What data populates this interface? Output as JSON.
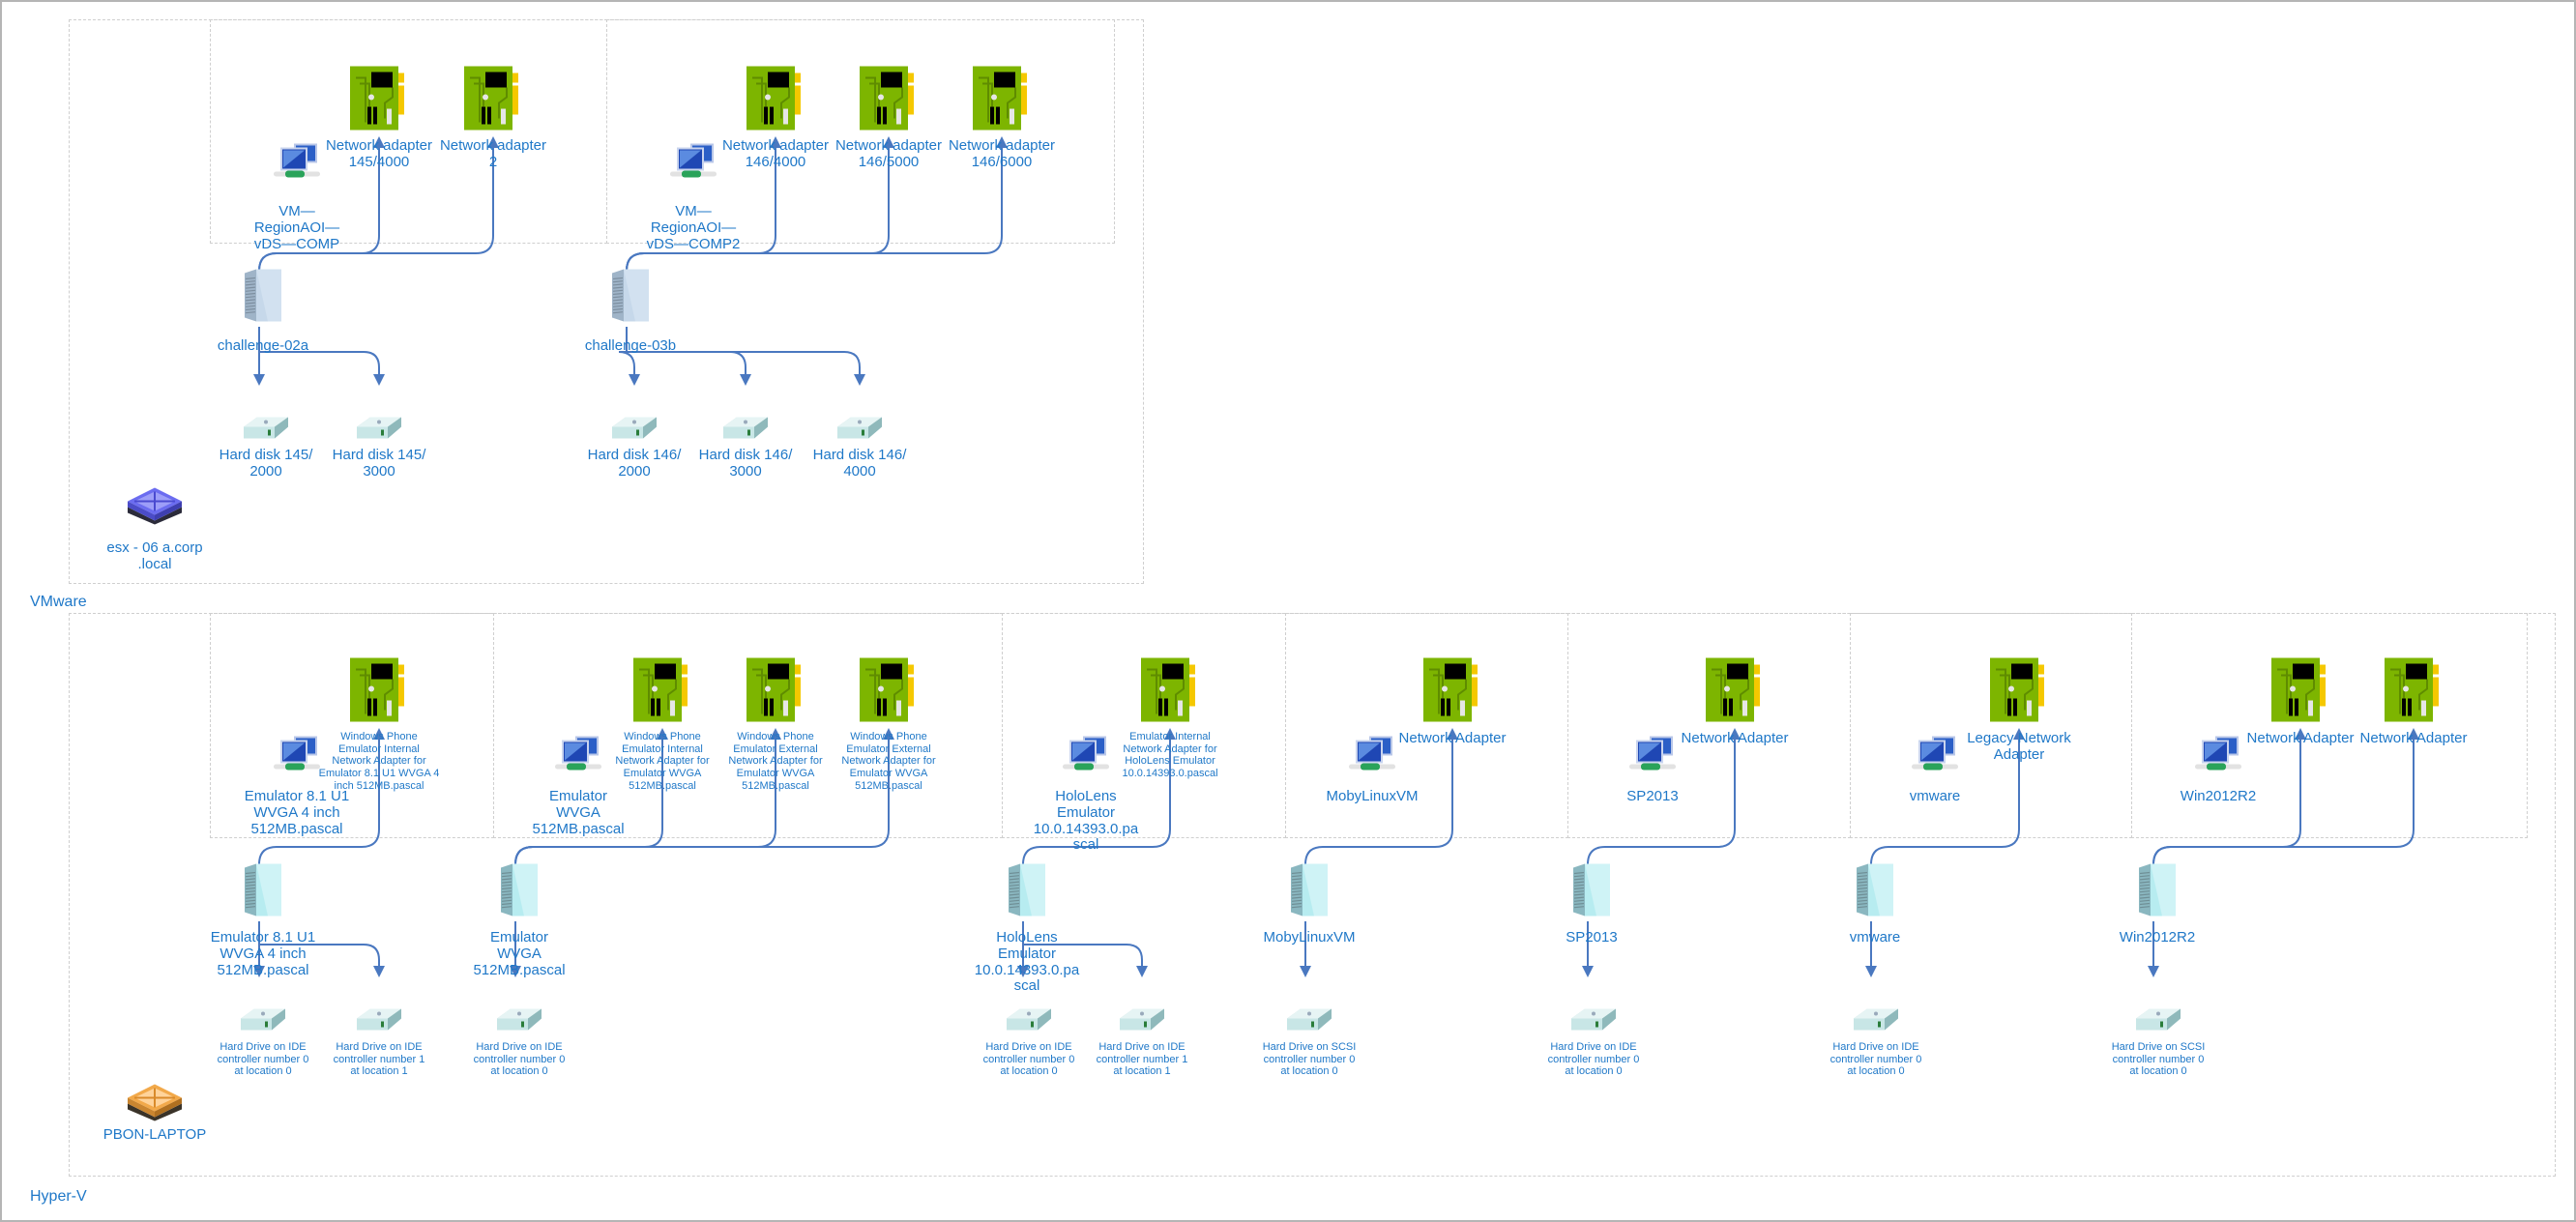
{
  "colors": {
    "text": "#1f78c8",
    "wire": "#4a78c0",
    "nic_green": "#7db500",
    "nic_yellow": "#f5c800"
  },
  "groups": {
    "vmware": {
      "label": "VMware",
      "host": {
        "label": "esx - 06 a.corp\n.local",
        "icon": "esx-host-icon"
      },
      "vms": [
        {
          "switch_label": "VM—\nRegionAOI—\nvDS—COMP",
          "server_label": "challenge-02a",
          "adapters": [
            "Network adapter\n145/4000",
            "Network adapter\n2"
          ],
          "disks": [
            "Hard disk 145/\n2000",
            "Hard disk 145/\n3000"
          ]
        },
        {
          "switch_label": "VM—\nRegionAOI—\nvDS—COMP2",
          "server_label": "challenge-03b",
          "adapters": [
            "Network adapter\n146/4000",
            "Network adapter\n146/5000",
            "Network adapter\n146/6000"
          ],
          "disks": [
            "Hard disk 146/\n2000",
            "Hard disk 146/\n3000",
            "Hard disk 146/\n4000"
          ]
        }
      ]
    },
    "hyperv": {
      "label": "Hyper-V",
      "host": {
        "label": "PBON-LAPTOP",
        "icon": "hyperv-host-icon"
      },
      "vms": [
        {
          "switch_label": "Emulator 8.1 U1\nWVGA 4 inch\n512MB.pascal",
          "server_label": "Emulator 8.1 U1\nWVGA 4 inch\n512MB.pascal",
          "adapters": [
            "Windows Phone\nEmulator Internal\nNetwork Adapter for\nEmulator 8.1 U1 WVGA 4\ninch 512MB.pascal"
          ],
          "disks": [
            "Hard Drive on IDE\ncontroller number 0\nat location 0",
            "Hard Drive on IDE\ncontroller number 1\nat location 1"
          ]
        },
        {
          "switch_label": "Emulator\nWVGA\n512MB.pascal",
          "server_label": "Emulator\nWVGA\n512MB.pascal",
          "adapters": [
            "Windows Phone\nEmulator Internal\nNetwork Adapter for\nEmulator WVGA\n512MB.pascal",
            "Windows Phone\nEmulator External\nNetwork Adapter for\nEmulator WVGA\n512MB.pascal",
            "Windows Phone\nEmulator External\nNetwork Adapter for\nEmulator WVGA\n512MB.pascal"
          ],
          "disks": [
            "Hard Drive on IDE\ncontroller number 0\nat location 0"
          ]
        },
        {
          "switch_label": "HoloLens\nEmulator\n10.0.14393.0.pa\nscal",
          "server_label": "HoloLens\nEmulator\n10.0.14393.0.pa\nscal",
          "adapters": [
            "Emulator Internal\nNetwork Adapter for\nHoloLens Emulator\n10.0.14393.0.pascal"
          ],
          "disks": [
            "Hard Drive on IDE\ncontroller number 0\nat location 0",
            "Hard Drive on IDE\ncontroller number 1\nat location 1"
          ]
        },
        {
          "switch_label": "MobyLinuxVM",
          "server_label": "MobyLinuxVM",
          "adapters": [
            "Network Adapter"
          ],
          "disks": [
            "Hard Drive on SCSI\ncontroller number 0\nat location 0"
          ]
        },
        {
          "switch_label": "SP2013",
          "server_label": "SP2013",
          "adapters": [
            "Network Adapter"
          ],
          "disks": [
            "Hard Drive on IDE\ncontroller number 0\nat location 0"
          ]
        },
        {
          "switch_label": "vmware",
          "server_label": "vmware",
          "adapters": [
            "Legacy Network\nAdapter"
          ],
          "disks": [
            "Hard Drive on IDE\ncontroller number 0\nat location 0"
          ]
        },
        {
          "switch_label": "Win2012R2",
          "server_label": "Win2012R2",
          "adapters": [
            "Network Adapter",
            "Network Adapter"
          ],
          "disks": [
            "Hard Drive on SCSI\ncontroller number 0\nat location 0"
          ]
        }
      ]
    }
  }
}
